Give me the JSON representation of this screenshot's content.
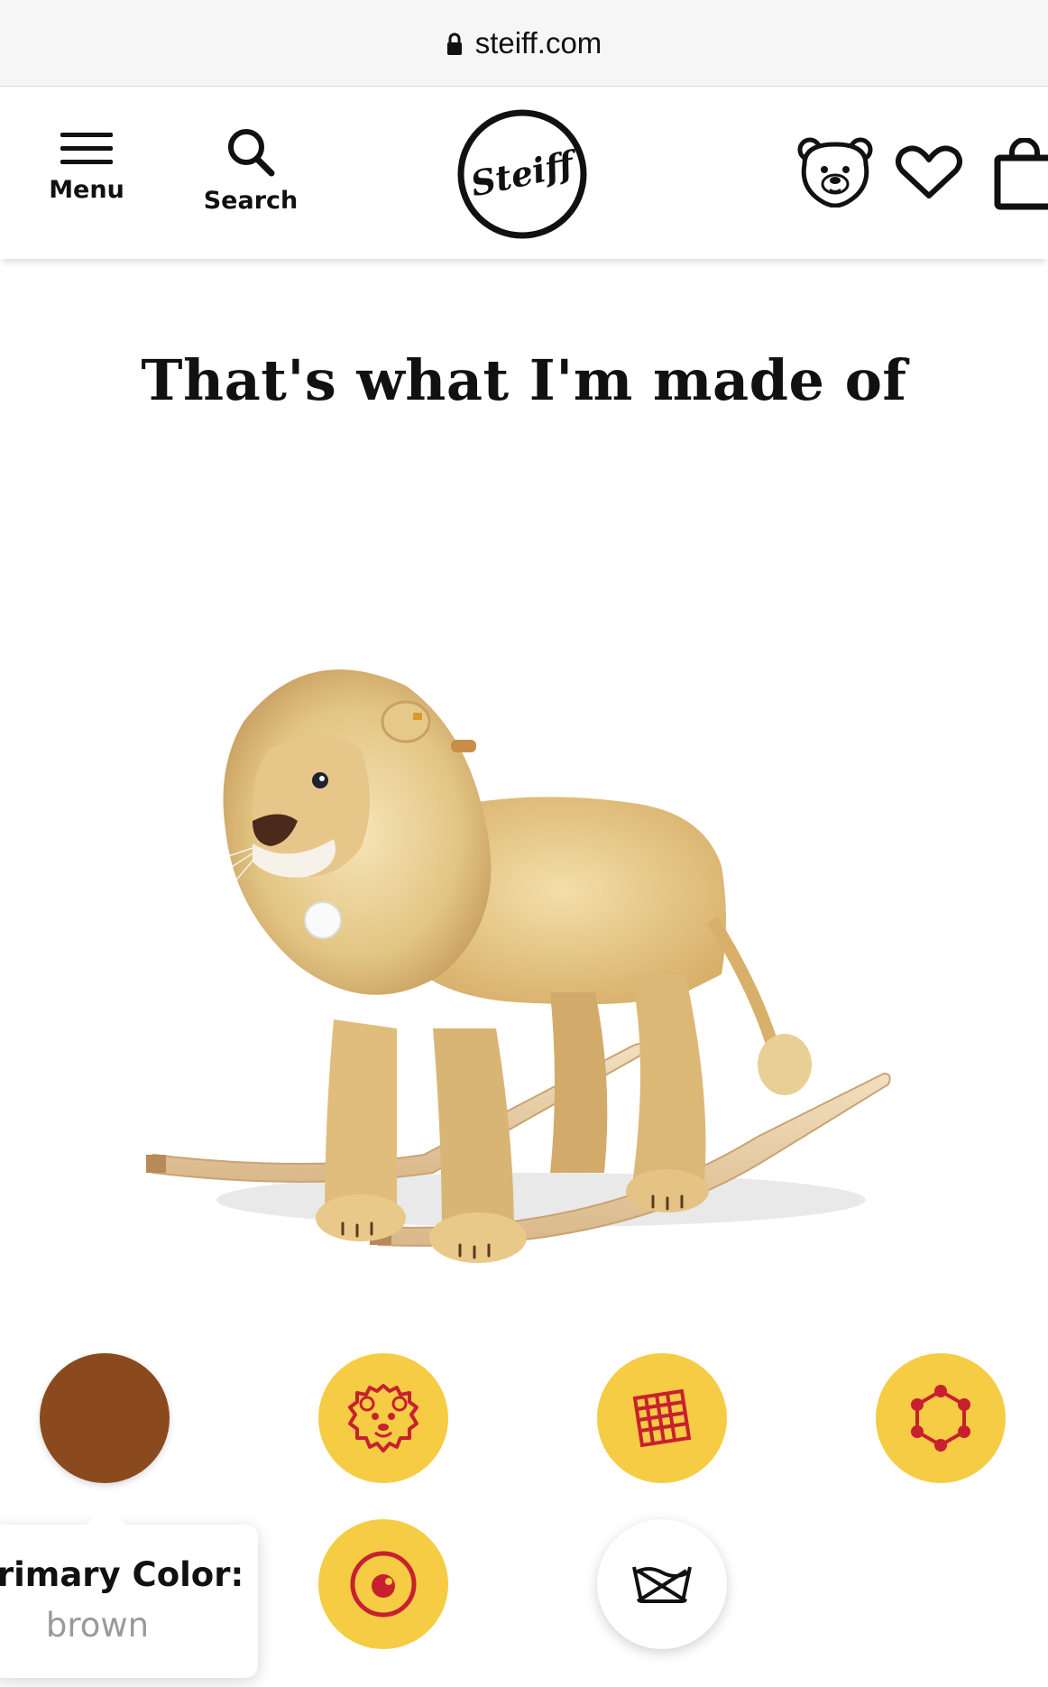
{
  "browser": {
    "domain": "steiff.com",
    "icons": {
      "lock": "lock-icon"
    }
  },
  "header": {
    "menu_label": "Menu",
    "search_label": "Search",
    "logo_text": "Steiff",
    "icons": [
      "hamburger-icon",
      "search-icon",
      "steiff-logo",
      "bear-account-icon",
      "heart-icon",
      "shopping-bag-icon"
    ]
  },
  "section": {
    "title": "That's what I'm made of"
  },
  "product": {
    "image": "lion-rocking-toy"
  },
  "materials": {
    "items": [
      {
        "name": "primary-color",
        "icon": "color-swatch",
        "color": "#8b4a1e"
      },
      {
        "name": "fur",
        "icon": "lion-head-icon",
        "color": "#f5cc44"
      },
      {
        "name": "fabric",
        "icon": "woven-fabric-icon",
        "color": "#f5cc44"
      },
      {
        "name": "filling",
        "icon": "molecule-icon",
        "color": "#f5cc44"
      },
      {
        "name": "eyes",
        "icon": "eye-icon",
        "color": "#f5cc44"
      },
      {
        "name": "care",
        "icon": "no-wash-icon",
        "color": "#ffffff"
      }
    ],
    "accent_color": "#c8202f"
  },
  "tooltip": {
    "label": "Primary Color:",
    "value": "brown"
  }
}
